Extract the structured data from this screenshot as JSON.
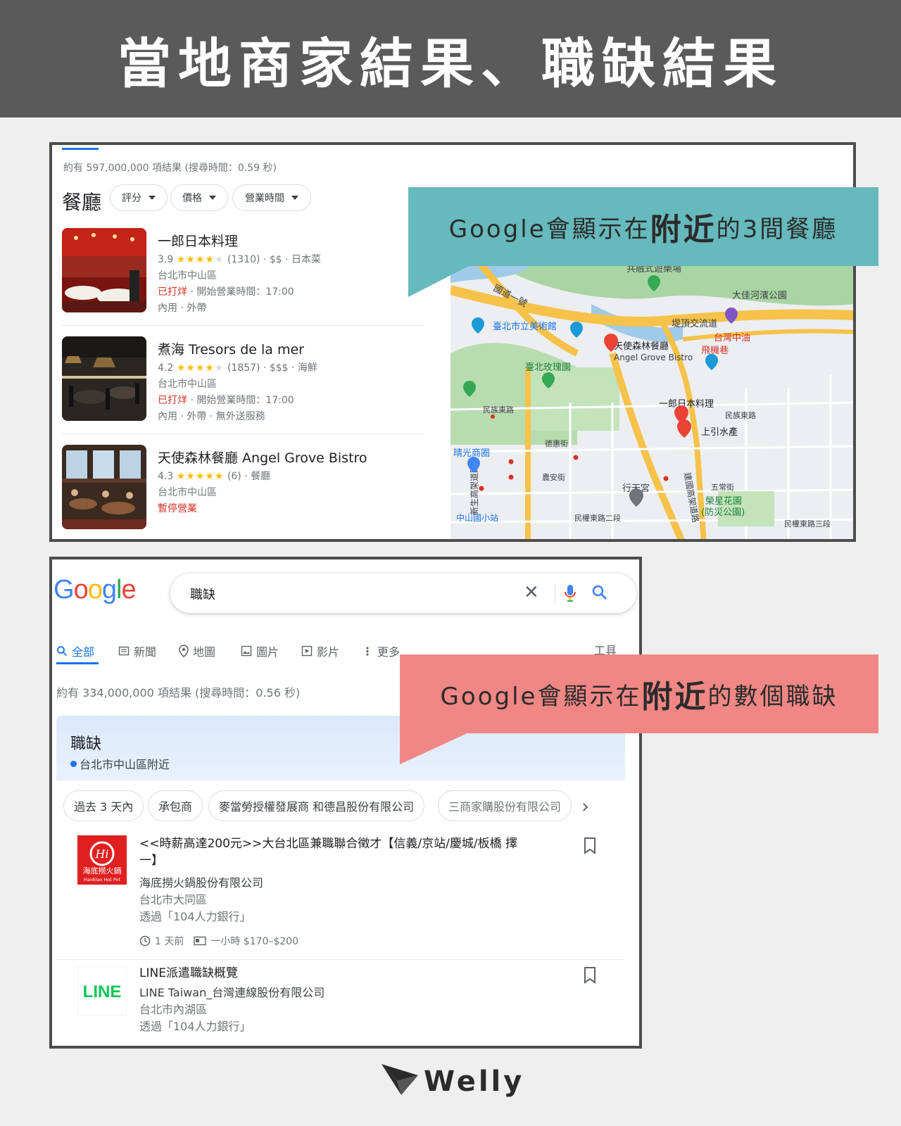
{
  "banner": {
    "title": "當地商家結果、職缺結果"
  },
  "restaurants_panel": {
    "result_count": "約有 597,000,000 項結果 (搜尋時間：0.59 秒)",
    "heading": "餐廳",
    "filters": [
      "評分",
      "價格",
      "營業時間"
    ],
    "items": [
      {
        "name": "一郎日本料理",
        "rating": "3.9",
        "stars_full": 4,
        "reviews": "(1310)",
        "price_type": " · $$ · 日本菜",
        "address": "台北市中山區",
        "status_red": "已打烊",
        "status_rest": " · 開始營業時間：17:00",
        "services": "內用 · 外帶"
      },
      {
        "name": "煮海 Tresors de la mer",
        "rating": "4.2",
        "stars_full": 4,
        "reviews": "(1857)",
        "price_type": " · $$$ · 海鮮",
        "address": "台北市中山區",
        "status_red": "已打烊",
        "status_rest": " · 開始營業時間：17:00",
        "services": "內用 · 外帶 · 無外送服務"
      },
      {
        "name": "天使森林餐廳 Angel Grove Bistro",
        "rating": "4.3",
        "stars_full": 4,
        "reviews": "(6)",
        "price_type": " · 餐廳",
        "address": "台北市中山區",
        "status_red": "暫停營業",
        "status_rest": "",
        "services": ""
      }
    ],
    "map_labels": {
      "park1": "共融式遊樂場",
      "park2": "大佳河濱公園",
      "road1": "國道一號",
      "road2": "堤頂交流道",
      "museum": "臺北市立美術館",
      "station": "台灣中油",
      "airport": "飛機巷",
      "restaurant": "天使森林餐廳",
      "restaurant_en": "Angel Grove Bistro",
      "rose": "臺北玫瑰園",
      "minzu": "民族東路",
      "minzu2": "民族東路",
      "ichiro": "一郎日本料理",
      "shangyin": "上引水產",
      "qingguang": "晴光商圈",
      "xingtian": "行天宮",
      "rongxing": "榮星花園",
      "rongxing2": "(防災公園)",
      "zhongshan": "中山國小站",
      "minquan": "民權東路二段",
      "minquan2": "民權東路三段",
      "dehui": "德惠街",
      "nongan": "農安街",
      "xinsheng": "新生高架道路",
      "jianguo": "建國高架道路",
      "ward": "五常街"
    },
    "callout": {
      "prefix": "Google會顯示在",
      "bold": "附近",
      "suffix": "的3間餐廳"
    }
  },
  "jobs_panel": {
    "logo": "Google",
    "search_value": "職缺",
    "tabs": [
      "全部",
      "新聞",
      "地圖",
      "圖片",
      "影片",
      "更多"
    ],
    "tools": "工具",
    "result_count": "約有 334,000,000 項結果 (搜尋時間：0.56 秒)",
    "widget_title": "職缺",
    "widget_location": "台北市中山區附近",
    "filters": [
      "過去 3 天內",
      "承包商",
      "麥當勞授權發展商 和德昌股份有限公司",
      "三商家購股份有限公司"
    ],
    "jobs": [
      {
        "title": "<<時薪高達200元>>大台北區兼職聯合徵才【信義/京站/慶城/板橋 擇一】",
        "company": "海底撈火鍋股份有限公司",
        "location": "台北市大同區",
        "via": "透過「104人力銀行」",
        "posted": "1 天前",
        "pay": "一小時 $170–$200",
        "logo_text": "海底撈火鍋",
        "logo_sub": "Haidilao Hot Pot"
      },
      {
        "title": "LINE派遣職缺概覽",
        "company": "LINE Taiwan_台灣連線股份有限公司",
        "location": "台北市內湖區",
        "via": "透過「104人力銀行」",
        "logo_text": "LINE"
      }
    ],
    "callout": {
      "prefix": "Google會顯示在",
      "bold": "附近",
      "suffix": "的數個職缺"
    }
  },
  "footer": {
    "brand": "Welly"
  },
  "colors": {
    "banner": "#5a5a5a",
    "teal": "#66b9bc",
    "coral": "#f08784",
    "google_blue": "#1a73e8",
    "star": "#fbbc04",
    "closed_red": "#d93025"
  }
}
